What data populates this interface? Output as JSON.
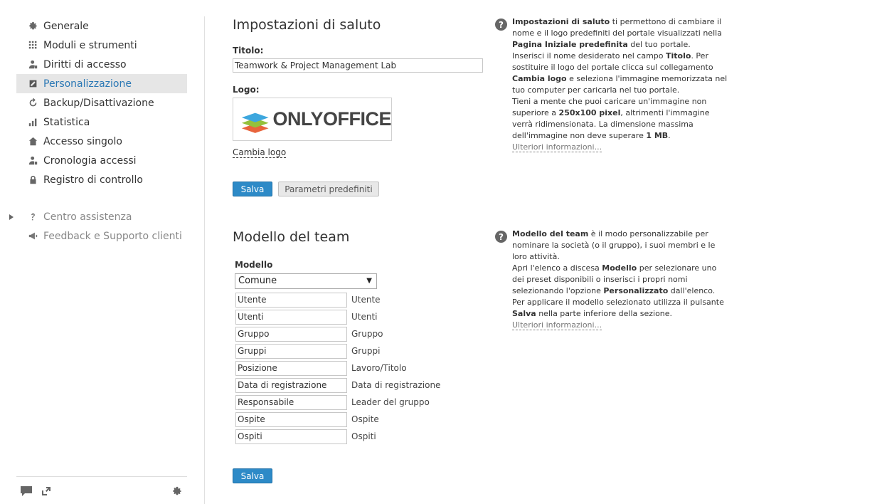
{
  "sidebar": {
    "items": [
      {
        "label": "Generale",
        "icon": "gear-icon"
      },
      {
        "label": "Moduli e strumenti",
        "icon": "grid-icon"
      },
      {
        "label": "Diritti di accesso",
        "icon": "user-key-icon"
      },
      {
        "label": "Personalizzazione",
        "icon": "edit-icon",
        "active": true
      },
      {
        "label": "Backup/Disattivazione",
        "icon": "refresh-icon"
      },
      {
        "label": "Statistica",
        "icon": "bar-chart-icon"
      },
      {
        "label": "Accesso singolo",
        "icon": "home-icon"
      },
      {
        "label": "Cronologia accessi",
        "icon": "user-lock-icon"
      },
      {
        "label": "Registro di controllo",
        "icon": "lock-icon"
      }
    ],
    "secondary": [
      {
        "label": "Centro assistenza",
        "icon": "question-icon"
      },
      {
        "label": "Feedback e Supporto clienti",
        "icon": "megaphone-icon"
      }
    ]
  },
  "greeting": {
    "title": "Impostazioni di saluto",
    "title_label": "Titolo:",
    "title_value": "Teamwork & Project Management Lab",
    "logo_label": "Logo:",
    "logo_text": "ONLYOFFICE",
    "change_logo": "Cambia logo",
    "save": "Salva",
    "defaults": "Parametri predefiniti"
  },
  "greeting_help": {
    "p1_b": "Impostazioni di saluto",
    "p1_a": " ti permettono di cambiare il nome e il logo predefiniti del portale visualizzati nella ",
    "p1_b2": "Pagina Iniziale predefinita",
    "p1_c": " del tuo portale.",
    "p2_a": "Inserisci il nome desiderato nel campo ",
    "p2_b": "Titolo",
    "p2_c": ". Per sostituire il logo del portale clicca sul collegamento ",
    "p2_b2": "Cambia logo",
    "p2_d": " e seleziona l'immagine memorizzata nel tuo computer per caricarla nel tuo portale.",
    "p3_a": "Tieni a mente che puoi caricare un'immagine non superiore a ",
    "p3_b": "250x100 pixel",
    "p3_c": ", altrimenti l'immagine verrà ridimensionata. La dimensione massima dell'immagine non deve superare ",
    "p3_b2": "1 MB",
    "p3_d": ".",
    "link": "Ulteriori informazioni..."
  },
  "team": {
    "title": "Modello del team",
    "model_label": "Modello",
    "selected": "Comune",
    "rows": [
      {
        "value": "Utente",
        "label": "Utente"
      },
      {
        "value": "Utenti",
        "label": "Utenti"
      },
      {
        "value": "Gruppo",
        "label": "Gruppo"
      },
      {
        "value": "Gruppi",
        "label": "Gruppi"
      },
      {
        "value": "Posizione",
        "label": "Lavoro/Titolo"
      },
      {
        "value": "Data di registrazione",
        "label": "Data di registrazione"
      },
      {
        "value": "Responsabile",
        "label": "Leader del gruppo"
      },
      {
        "value": "Ospite",
        "label": "Ospite"
      },
      {
        "value": "Ospiti",
        "label": "Ospiti"
      }
    ],
    "save": "Salva"
  },
  "team_help": {
    "p1_b": "Modello del team",
    "p1_a": " è il modo personalizzabile per nominare la società (o il gruppo), i suoi membri e le loro attività.",
    "p2_a": "Apri l'elenco a discesa ",
    "p2_b": "Modello",
    "p2_c": " per selezionare uno dei preset disponibili o inserisci i propri nomi selezionando l'opzione ",
    "p2_b2": "Personalizzato",
    "p2_d": " dall'elenco.",
    "p3_a": "Per applicare il modello selezionato utilizza il pulsante ",
    "p3_b": "Salva",
    "p3_c": " nella parte inferiore della sezione.",
    "link": "Ulteriori informazioni..."
  }
}
